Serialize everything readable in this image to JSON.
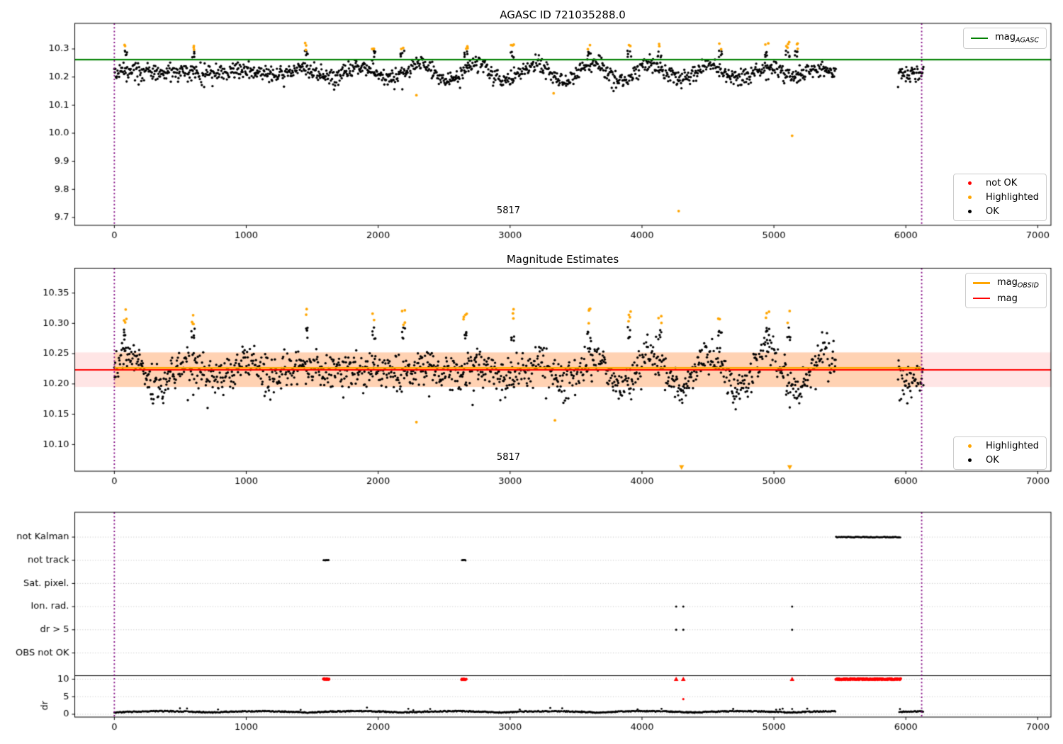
{
  "titles": {
    "top": "AGASC ID 721035288.0",
    "middle": "Magnitude Estimates"
  },
  "obsid_label": "5817",
  "legends": {
    "mag_agasc": [
      {
        "main": "mag",
        "sub": "AGASC",
        "color": "#008000",
        "width": 2.5
      }
    ],
    "top_markers": [
      {
        "label": "not OK",
        "color": "#ff0000"
      },
      {
        "label": "Highlighted",
        "color": "#ffa500"
      },
      {
        "label": "OK",
        "color": "#000000"
      }
    ],
    "mid_lines": [
      {
        "main": "mag",
        "sub": "OBSID",
        "color": "#ffa500",
        "width": 3
      },
      {
        "main": "mag",
        "sub": "",
        "color": "#ff0000",
        "width": 2.5
      }
    ],
    "mid_markers": [
      {
        "label": "Highlighted",
        "color": "#ffa500"
      },
      {
        "label": "OK",
        "color": "#000000"
      }
    ]
  },
  "chart_data": [
    {
      "type": "scatter",
      "title": "AGASC ID 721035288.0",
      "xlim": [
        -300,
        7100
      ],
      "ylim": [
        9.672,
        10.391
      ],
      "xticks": [
        0,
        1000,
        2000,
        3000,
        4000,
        5000,
        6000,
        7000
      ],
      "yticks": [
        9.7,
        9.8,
        9.9,
        10.0,
        10.1,
        10.2,
        10.3
      ],
      "ytick_labels": [
        "9.7",
        "9.8",
        "9.9",
        "10.0",
        "10.1",
        "10.2",
        "10.3"
      ],
      "data_segments": [
        [
          0,
          5470
        ],
        [
          5941,
          6135
        ]
      ],
      "band": {
        "mean": 10.218,
        "amp": 0.034,
        "period": 440,
        "noise": 0.016,
        "ymin": 10.148,
        "ymax": 10.302
      },
      "mag_line": {
        "value": 10.262,
        "color": "#008000"
      },
      "vlines": {
        "x": [
          0,
          6120
        ],
        "color": "#800080"
      },
      "highlight_color": "#ffa500",
      "highlight_clusters": [
        86,
        597,
        1452,
        1963,
        2183,
        2667,
        3016,
        3602,
        3903,
        4134,
        4590,
        4947,
        5105,
        5168
      ],
      "highlight_low": [
        [
          2290,
          10.135
        ],
        [
          3330,
          10.142
        ],
        [
          4278,
          9.723
        ],
        [
          5138,
          9.991
        ]
      ],
      "obsid_text_x": 2990
    },
    {
      "type": "scatter",
      "title": "Magnitude Estimates",
      "xlim": [
        -300,
        7100
      ],
      "ylim": [
        10.056,
        10.391
      ],
      "xticks": [
        0,
        1000,
        2000,
        3000,
        4000,
        5000,
        6000,
        7000
      ],
      "yticks": [
        10.1,
        10.15,
        10.2,
        10.25,
        10.3,
        10.35
      ],
      "ytick_labels": [
        "10.10",
        "10.15",
        "10.20",
        "10.25",
        "10.30",
        "10.35"
      ],
      "data_segments": [
        [
          0,
          5470
        ],
        [
          5941,
          6135
        ]
      ],
      "band": {
        "mean": 10.222,
        "amp": 0.034,
        "period": 440,
        "noise": 0.017,
        "ymin": 10.14,
        "ymax": 10.305
      },
      "mag_line": {
        "value": 10.2232,
        "color": "#ff0000"
      },
      "mag_err_band": {
        "lo": 10.195,
        "hi": 10.252,
        "color": "rgba(255,0,0,0.10)"
      },
      "obsid_band": {
        "lo": 10.195,
        "hi": 10.252,
        "x0": 0,
        "x1": 6120,
        "color": "rgba(255,140,0,0.22)"
      },
      "obsid_line": {
        "value": 10.2265,
        "x0": 0,
        "x1": 6120,
        "color": "#ffa500"
      },
      "vlines": {
        "x": [
          0,
          6120
        ],
        "color": "#800080"
      },
      "highlight_color": "#ffa500",
      "highlight_clusters": [
        86,
        597,
        1452,
        1970,
        2190,
        2660,
        3020,
        3600,
        3905,
        4135,
        4590,
        4950,
        5110
      ],
      "highlight_low": [
        [
          2290,
          10.137
        ],
        [
          3340,
          10.14
        ]
      ],
      "clip_low_x": [
        4300,
        5120
      ],
      "obsid_text_x": 2990
    },
    {
      "type": "flags",
      "xlim": [
        -300,
        7100
      ],
      "xticks": [
        0,
        1000,
        2000,
        3000,
        4000,
        5000,
        6000,
        7000
      ],
      "flag_rows": [
        "not Kalman",
        "not track",
        "Sat. pixel.",
        "Ion. rad.",
        "dr > 5",
        "OBS not OK"
      ],
      "dr_ticks": [
        10,
        5,
        0
      ],
      "dr_axis_label": "dr",
      "clip_line_value": 11,
      "flag_segments": {
        "not Kalman": [
          [
            5470,
            5960
          ]
        ],
        "not track": [
          [
            1585,
            1625
          ],
          [
            2635,
            2665
          ]
        ]
      },
      "flag_points": {
        "Ion. rad.": [
          4259,
          4313,
          5138
        ],
        "dr > 5": [
          4259,
          4313,
          5138
        ]
      },
      "red_color": "#ff0000",
      "red_segments": [
        [
          1585,
          1625
        ],
        [
          2635,
          2665
        ],
        [
          5470,
          5960
        ]
      ],
      "red_triangles": [
        4259,
        4313,
        5138
      ],
      "red_points": [
        [
          4313,
          4.3
        ]
      ],
      "black_points": [
        [
          5138,
          1.5
        ]
      ],
      "dr_trace": {
        "segments": [
          [
            0,
            5470
          ],
          [
            5950,
            6135
          ]
        ],
        "base": 0.35,
        "noise": 0.5
      },
      "vlines": {
        "x": [
          0,
          6120
        ],
        "color": "#800080"
      }
    }
  ]
}
